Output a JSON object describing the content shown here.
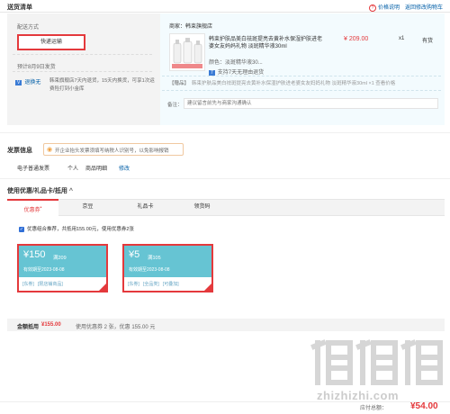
{
  "header": {
    "title": "送货清单",
    "price_note": "价格说明",
    "back_cart": "返回修改购物车"
  },
  "shipping": {
    "method_label": "配送方式",
    "method_btn": "快递运输",
    "time": "预计8月9日发货",
    "service_badge": "退换无",
    "service_text": "韩束旗舰店7天内退货，15天内换货，可享1次运费险打到小金库"
  },
  "goods": {
    "shop": "商家：韩束旗舰店",
    "name": "韩束护肤品美白祛斑提亮去黄补水保湿护肤进老婆女友妈妈礼物 淡斑精华液30ml",
    "price": "¥ 209.00",
    "qty": "x1",
    "stock": "有货",
    "color": "颜色：淡斑精华液30...",
    "service_tag": "支持7天无理由退货",
    "gift_label": "【赠品】",
    "gift_text": "韩束护肤品美白祛斑提亮去黄补水保湿护肤进老婆女友妈妈礼物 淡斑精华液30ml ×1 查看价格",
    "remark_label": "备注：",
    "remark_placeholder": "建议留言前先与商家沟通确认"
  },
  "invoice": {
    "title": "发票信息",
    "tip": "开企业抬头发票须填写纳税人识别号，以免影响报销",
    "type": "电子普通发票",
    "person": "个人",
    "detail": "商品明细",
    "edit": "修改"
  },
  "discount": {
    "title": "使用优惠/礼品卡/抵用",
    "tabs": [
      "优惠券",
      "京豆",
      "礼品卡",
      "领货码"
    ],
    "combo_text": "优惠组合推荐，共抵用155.00元，使用优惠券2张",
    "coupons": [
      {
        "symbol": "¥",
        "amount": "150",
        "cond": "满209",
        "expire": "有效期至2023-08-08",
        "tags": "[东券]   [限店铺商品]"
      },
      {
        "symbol": "¥",
        "amount": "5",
        "cond": "满105",
        "expire": "有效期至2023-08-08",
        "tags": "[东券]   [全品类]   [可叠加]"
      }
    ],
    "summary_label": "金额抵用",
    "summary_amount": "¥155.00",
    "summary_text": "使用优惠券 2 张，优惠 155.00 元"
  },
  "footer": {
    "payable_label": "应付总额：",
    "payable": "¥54.00"
  },
  "watermark": {
    "text": "zhizhizhi.com"
  }
}
